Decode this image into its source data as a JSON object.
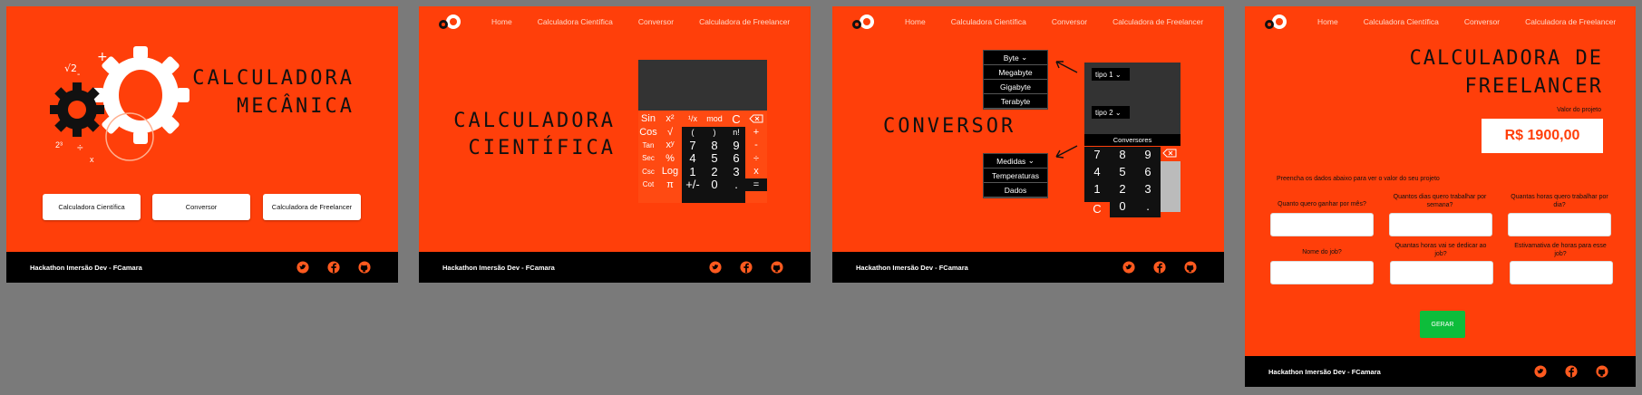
{
  "screen1": {
    "title_line1": "CALCULADORA",
    "title_line2": "MECÂNICA",
    "buttons": [
      "Calculadora Científica",
      "Conversor",
      "Calculadora de Freelancer"
    ]
  },
  "nav": [
    "Home",
    "Calculadora Científica",
    "Conversor",
    "Calculadora de Freelancer"
  ],
  "footer": {
    "text": "Hackathon Imersão Dev - FCamara",
    "icons": [
      "twitter-icon",
      "facebook-icon",
      "github-icon"
    ]
  },
  "screen2": {
    "title_line1": "CALCULADORA",
    "title_line2": "CIENTÍFICA",
    "keys_left": [
      "Sin",
      "Cos",
      "Tan",
      "Sec",
      "Csc",
      "Cot"
    ],
    "keys_col2": [
      "x²",
      "√",
      "xʸ",
      "%",
      "Log",
      "π"
    ],
    "keys_row1": [
      "¹/x",
      "mod",
      "C"
    ],
    "keys_row2": [
      "(",
      ")",
      "n!"
    ],
    "digits": [
      "7",
      "8",
      "9",
      "4",
      "5",
      "6",
      "1",
      "2",
      "3",
      "+/-",
      "0",
      "."
    ],
    "ops": [
      "+",
      "-",
      "÷",
      "x",
      "="
    ]
  },
  "screen3": {
    "title": "CONVERSOR",
    "menu1": [
      "Byte",
      "Megabyte",
      "Gigabyte",
      "Terabyte"
    ],
    "menu2": [
      "Medidas",
      "Temperaturas",
      "Dados"
    ],
    "select1": "tipo 1",
    "select2": "tipo 2",
    "bar": "Conversores",
    "digits": [
      "7",
      "8",
      "9",
      "4",
      "5",
      "6",
      "1",
      "2",
      "3",
      "C",
      "0",
      "."
    ]
  },
  "screen4": {
    "title_line1": "CALCULADORA DE",
    "title_line2": "FREELANCER",
    "value_label": "Valor do projeto",
    "value": "R$ 1900,00",
    "intro": "Preencha os dados abaixo para ver o valor do seu projeto",
    "fields": [
      "Quanto quero ganhar por mês?",
      "Quantos dias quero trabalhar por semana?",
      "Quantas horas quero trabalhar por dia?",
      "Nome do job?",
      "Quantas horas vai se dedicar ao job?",
      "Estivamativa de horas para esse job?"
    ],
    "button": "GERAR"
  }
}
